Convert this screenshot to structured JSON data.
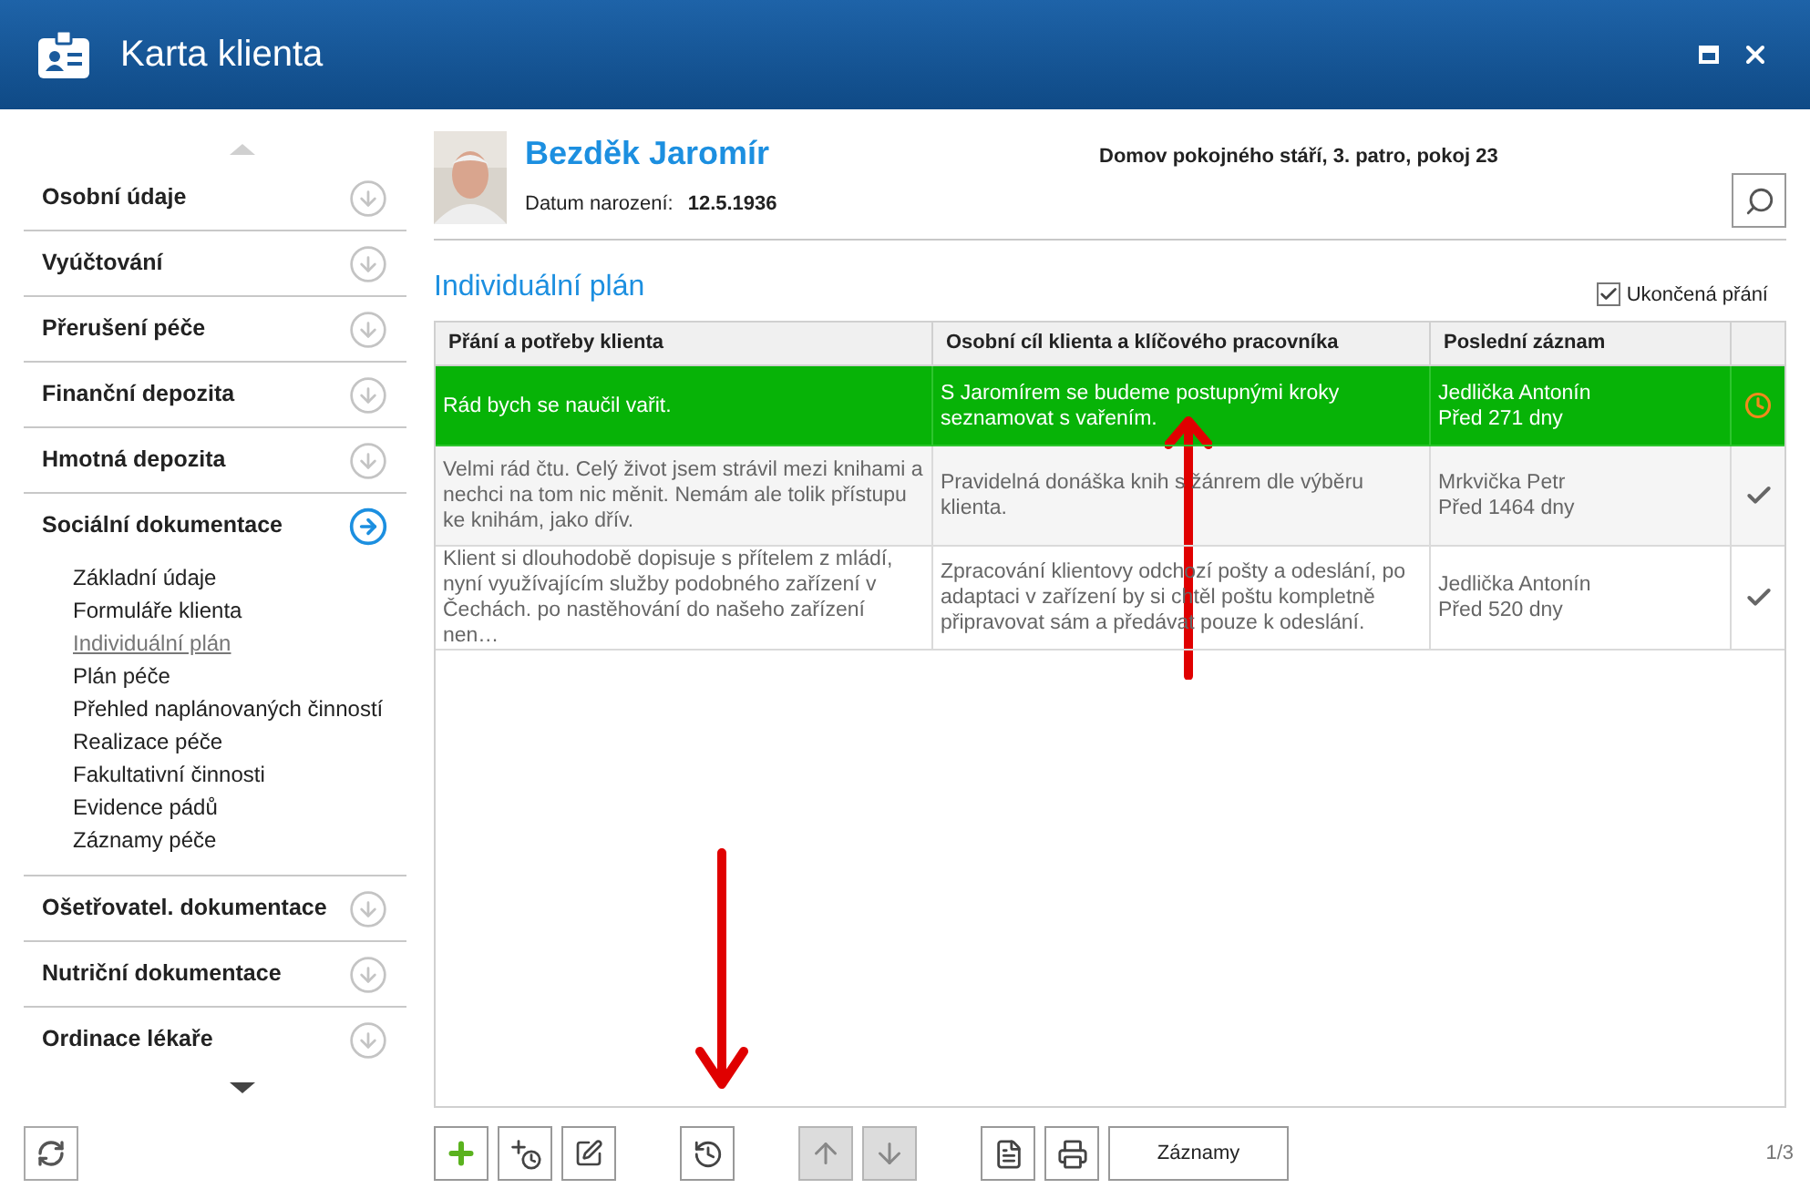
{
  "window": {
    "title": "Karta klienta"
  },
  "sidebar": {
    "sections": [
      {
        "label": "Osobní údaje",
        "expanded": false
      },
      {
        "label": "Vyúčtování",
        "expanded": false
      },
      {
        "label": "Přerušení péče",
        "expanded": false
      },
      {
        "label": "Finanční depozita",
        "expanded": false
      },
      {
        "label": "Hmotná depozita",
        "expanded": false
      },
      {
        "label": "Sociální dokumentace",
        "expanded": true,
        "children": [
          {
            "label": "Základní údaje",
            "selected": false
          },
          {
            "label": "Formuláře klienta",
            "selected": false
          },
          {
            "label": "Individuální plán",
            "selected": true
          },
          {
            "label": "Plán péče",
            "selected": false
          },
          {
            "label": "Přehled naplánovaných činností",
            "selected": false
          },
          {
            "label": "Realizace péče",
            "selected": false
          },
          {
            "label": "Fakultativní činnosti",
            "selected": false
          },
          {
            "label": "Evidence pádů",
            "selected": false
          },
          {
            "label": "Záznamy péče",
            "selected": false
          }
        ]
      },
      {
        "label": "Ošetřovatel. dokumentace",
        "expanded": false
      },
      {
        "label": "Nutriční dokumentace",
        "expanded": false
      },
      {
        "label": "Ordinace lékaře",
        "expanded": false
      }
    ]
  },
  "client": {
    "name": "Bezděk Jaromír",
    "birth_label": "Datum narození:",
    "birth_date": "12.5.1936",
    "location": "Domov pokojného stáří, 3. patro, pokoj 23"
  },
  "plan": {
    "title": "Individuální plán",
    "finished_filter": {
      "label": "Ukončená přání",
      "checked": true
    },
    "columns": [
      "Přání a potřeby klienta",
      "Osobní cíl klienta a klíčového pracovníka",
      "Poslední záznam"
    ],
    "rows": [
      {
        "wish": "Rád bych se naučil vařit.",
        "goal": "S Jaromírem se budeme postupnými kroky seznamovat s vařením.",
        "worker": "Jedlička Antonín",
        "age": "Před 271 dny",
        "kind": "pending",
        "selected": true
      },
      {
        "wish": "Velmi rád čtu. Celý život jsem strávil mezi knihami a nechci na tom nic měnit. Nemám ale tolik přístupu ke knihám, jako dřív.",
        "goal": "Pravidelná donáška knih s žánrem dle výběru klienta.",
        "worker": "Mrkvička Petr",
        "age": "Před 1464 dny",
        "kind": "done",
        "selected": false
      },
      {
        "wish": "Klient si dlouhodobě dopisuje s přítelem z mládí, nyní využívajícím služby podobného zařízení v Čechách. po nastěhování do našeho zařízení nen…",
        "goal": "Zpracování klientovy odchozí pošty a odeslání, po adaptaci v zařízení by si chtěl poštu kompletně připravovat sám a předávat pouze k odeslání.",
        "worker": "Jedlička Antonín",
        "age": "Před 520 dny",
        "kind": "done",
        "selected": false
      }
    ]
  },
  "toolbar": {
    "buttons": [
      {
        "kind": "add",
        "disabled": false
      },
      {
        "kind": "add-timed",
        "disabled": false
      },
      {
        "kind": "edit",
        "disabled": false
      },
      {
        "kind": "gap"
      },
      {
        "kind": "history",
        "disabled": false
      },
      {
        "kind": "gap"
      },
      {
        "kind": "up",
        "disabled": true
      },
      {
        "kind": "down",
        "disabled": true
      },
      {
        "kind": "gap"
      },
      {
        "kind": "document",
        "disabled": false
      },
      {
        "kind": "print",
        "disabled": false
      },
      {
        "kind": "gap"
      }
    ],
    "records_button": "Záznamy",
    "page": "1/3"
  }
}
